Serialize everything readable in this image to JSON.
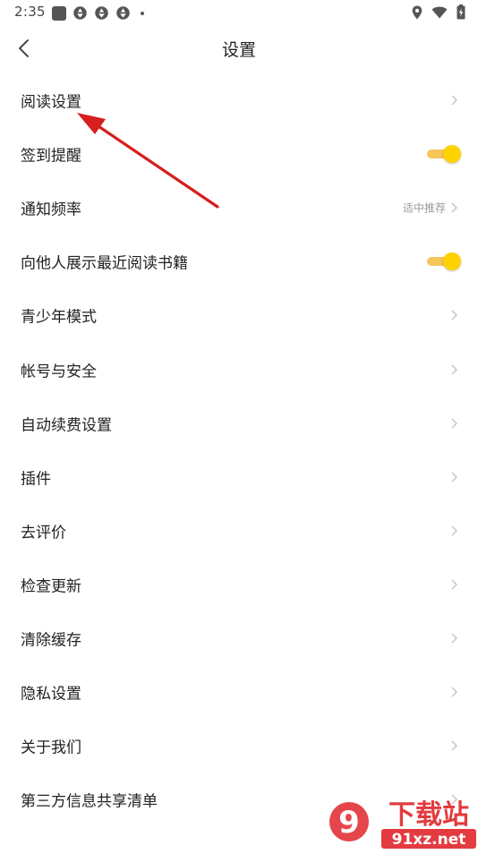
{
  "status_bar": {
    "time": "2:35",
    "left_icons": [
      "app-square-icon",
      "app-aperture-icon",
      "app-aperture-icon",
      "app-aperture-icon",
      "more-notifications-dot-icon"
    ],
    "right_icons": [
      "location-icon",
      "wifi-icon",
      "battery-charging-icon"
    ]
  },
  "header": {
    "title": "设置",
    "back_icon": "chevron-left-icon"
  },
  "settings": {
    "items": [
      {
        "label": "阅读设置",
        "control": "chevron"
      },
      {
        "label": "签到提醒",
        "control": "toggle",
        "on": true
      },
      {
        "label": "通知频率",
        "control": "chevron",
        "value": "适中推荐"
      },
      {
        "label": "向他人展示最近阅读书籍",
        "control": "toggle",
        "on": true
      },
      {
        "label": "青少年模式",
        "control": "chevron"
      },
      {
        "label": "帐号与安全",
        "control": "chevron"
      },
      {
        "label": "自动续费设置",
        "control": "chevron"
      },
      {
        "label": "插件",
        "control": "chevron"
      },
      {
        "label": "去评价",
        "control": "chevron"
      },
      {
        "label": "检查更新",
        "control": "chevron"
      },
      {
        "label": "清除缓存",
        "control": "chevron"
      },
      {
        "label": "隐私设置",
        "control": "chevron"
      },
      {
        "label": "关于我们",
        "control": "chevron"
      },
      {
        "label": "第三方信息共享清单",
        "control": "chevron"
      }
    ]
  },
  "colors": {
    "toggle_thumb": "#ffd200",
    "toggle_track": "#f7c65a",
    "annotation_arrow": "#d81e1e",
    "watermark_red": "#e0262b"
  },
  "watermark": {
    "text_main": "下载站",
    "text_url": "91xz.net",
    "logo_glyph": "9"
  }
}
